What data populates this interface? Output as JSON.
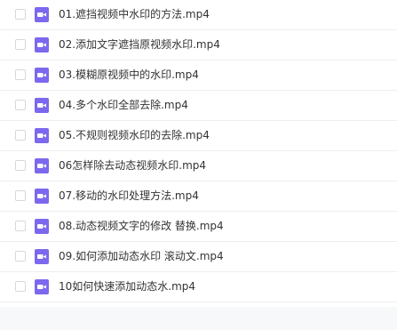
{
  "files": [
    {
      "name": "01.遮挡视频中水印的方法.mp4"
    },
    {
      "name": "02.添加文字遮挡原视频水印.mp4"
    },
    {
      "name": "03.模糊原视频中的水印.mp4"
    },
    {
      "name": "04.多个水印全部去除.mp4"
    },
    {
      "name": "05.不规则视频水印的去除.mp4"
    },
    {
      "name": "06怎样除去动态视频水印.mp4"
    },
    {
      "name": "07.移动的水印处理方法.mp4"
    },
    {
      "name": "08.动态视频文字的修改 替换.mp4"
    },
    {
      "name": "09.如何添加动态水印 滚动文.mp4"
    },
    {
      "name": "10如何快速添加动态水.mp4"
    }
  ],
  "colors": {
    "icon": "#7b68ee",
    "icon_glyph": "#ffffff",
    "text": "#333333",
    "divider": "#eeeeee"
  }
}
